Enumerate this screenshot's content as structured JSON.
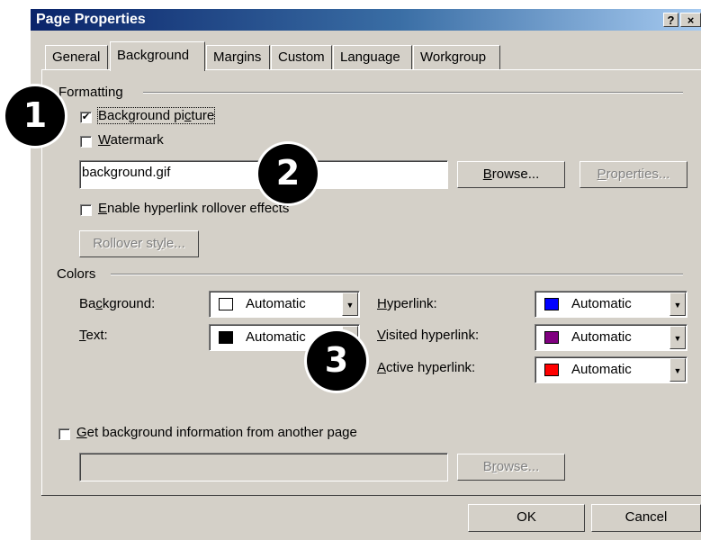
{
  "window": {
    "title": "Page Properties",
    "help_btn": "?",
    "close_btn": "×"
  },
  "tabs": [
    "General",
    "Background",
    "Margins",
    "Custom",
    "Language",
    "Workgroup"
  ],
  "formatting": {
    "group_label": "Formatting",
    "background_picture": {
      "pre": "Background pi",
      "key": "c",
      "post": "ture",
      "checked": true
    },
    "watermark": {
      "key": "W",
      "post": "atermark",
      "checked": false
    },
    "file_value": "background.gif",
    "browse": {
      "key": "B",
      "post": "rowse..."
    },
    "properties": {
      "key": "P",
      "post": "roperties..."
    },
    "rollover": {
      "key": "E",
      "post": "nable hyperlink rollover effects",
      "checked": false
    },
    "rollover_style": {
      "pre": "Rollover st",
      "key": "y",
      "post": "le..."
    }
  },
  "colors": {
    "group_label": "Colors",
    "background": {
      "pre": "Ba",
      "key": "c",
      "post": "kground:",
      "value": "Automatic",
      "swatch": "#ffffff"
    },
    "text": {
      "key": "T",
      "post": "ext:",
      "value": "Automatic",
      "swatch": "#000000"
    },
    "hyperlink": {
      "key": "H",
      "post": "yperlink:",
      "value": "Automatic",
      "swatch": "#0000ff"
    },
    "visited": {
      "key": "V",
      "post": "isited hyperlink:",
      "value": "Automatic",
      "swatch": "#800080"
    },
    "active": {
      "key": "A",
      "post": "ctive hyperlink:",
      "value": "Automatic",
      "swatch": "#ff0000"
    }
  },
  "get_background": {
    "key": "G",
    "post": "et background information from another page",
    "checked": false,
    "value": ""
  },
  "browse2": {
    "key": "r",
    "pre": "B",
    "post": "owse..."
  },
  "footer": {
    "ok": "OK",
    "cancel": "Cancel"
  },
  "markers": [
    "1",
    "2",
    "3"
  ]
}
